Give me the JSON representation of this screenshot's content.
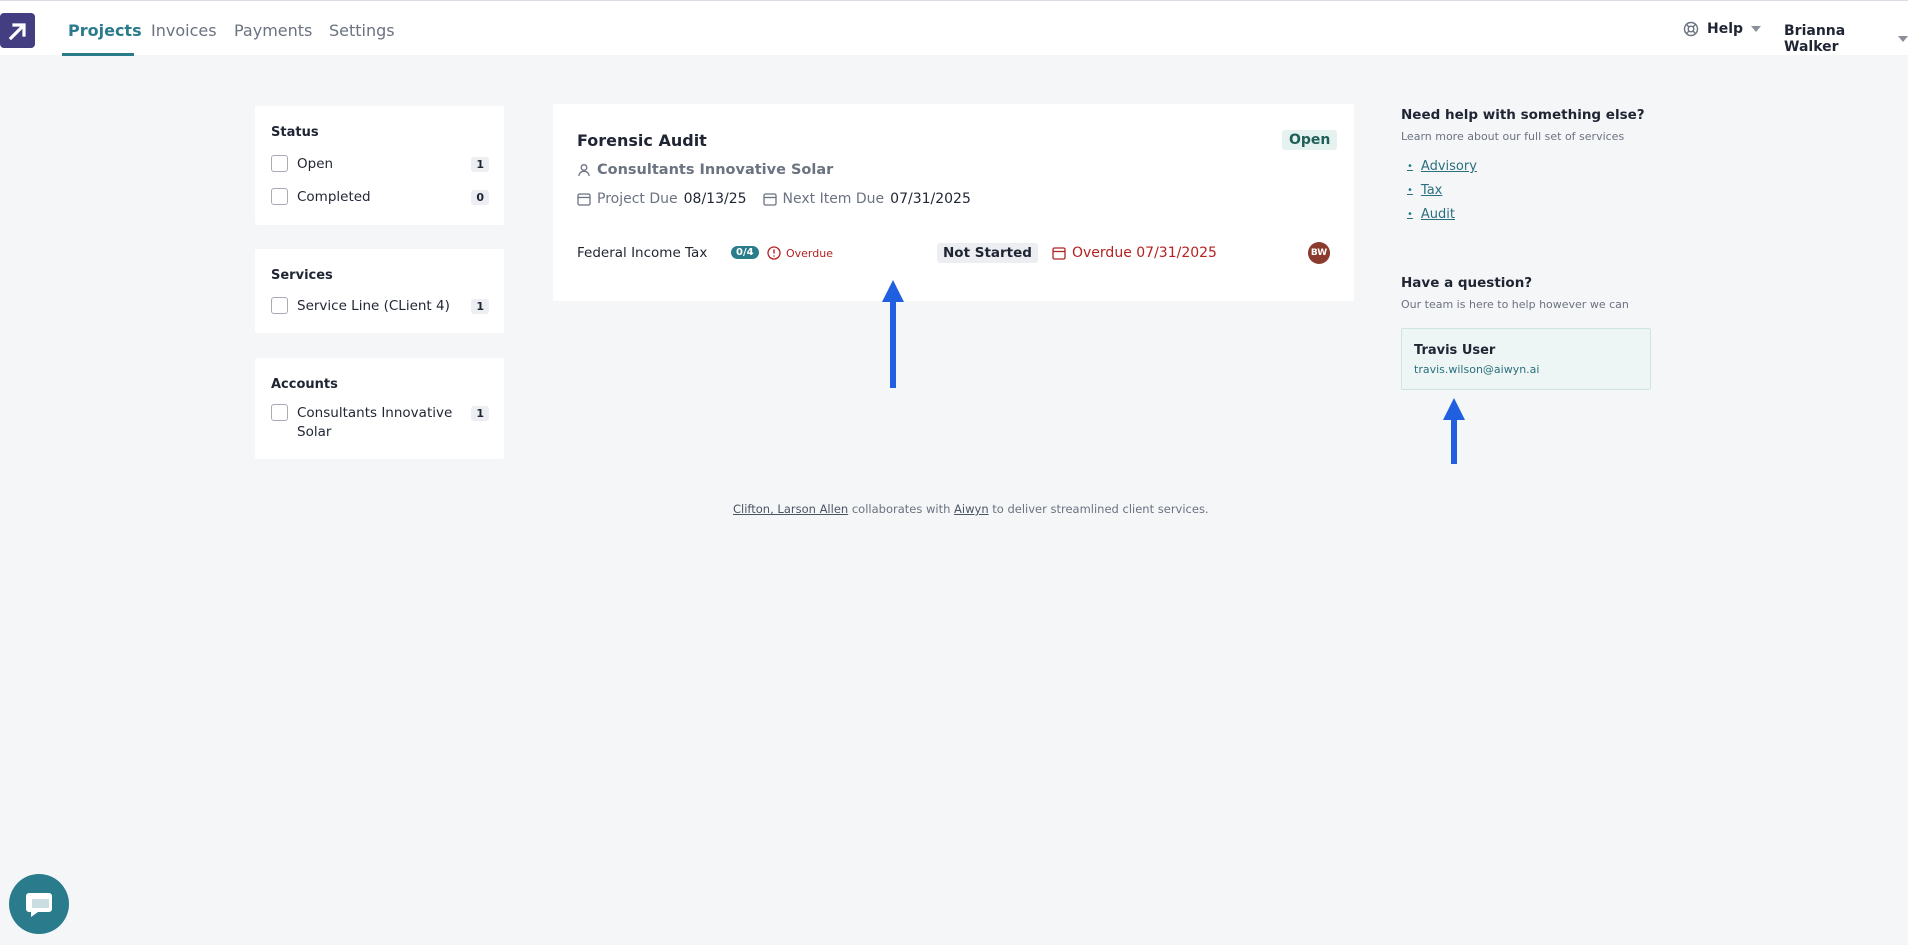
{
  "nav": {
    "tabs": [
      {
        "label": "Projects",
        "active": true
      },
      {
        "label": "Invoices",
        "active": false
      },
      {
        "label": "Payments",
        "active": false
      },
      {
        "label": "Settings",
        "active": false
      }
    ],
    "help_label": "Help",
    "user_name": "Brianna Walker"
  },
  "filters": {
    "status": {
      "title": "Status",
      "items": [
        {
          "label": "Open",
          "count": "1"
        },
        {
          "label": "Completed",
          "count": "0"
        }
      ]
    },
    "services": {
      "title": "Services",
      "items": [
        {
          "label": "Service Line (CLient 4)",
          "count": "1"
        }
      ]
    },
    "accounts": {
      "title": "Accounts",
      "items": [
        {
          "label": "Consultants Innovative Solar",
          "count": "1"
        }
      ]
    }
  },
  "project": {
    "title": "Forensic Audit",
    "status": "Open",
    "client": "Consultants Innovative Solar",
    "project_due_label": "Project Due",
    "project_due": "08/13/25",
    "next_item_due_label": "Next Item Due",
    "next_item_due": "07/31/2025",
    "task": {
      "name": "Federal Income Tax",
      "progress": "0/4",
      "overdue_flag": "Overdue",
      "status": "Not Started",
      "due": "Overdue 07/31/2025",
      "assignee_initials": "BW"
    }
  },
  "help_panel": {
    "heading": "Need help with something else?",
    "subheading": "Learn more about our full set of services",
    "links": [
      "Advisory",
      "Tax",
      "Audit"
    ],
    "question_heading": "Have a question?",
    "question_sub": "Our team is here to help however we can",
    "contact_name": "Travis User",
    "contact_email": "travis.wilson@aiwyn.ai"
  },
  "footer": {
    "firm": "Clifton, Larson Allen",
    "mid": " collaborates with ",
    "partner": "Aiwyn",
    "end": " to deliver streamlined client services."
  },
  "colors": {
    "accent": "#2a7c8c",
    "brand_logo": "#433d82",
    "overdue": "#b32121",
    "annotation_arrow": "#1f5fe0"
  },
  "icons": [
    "logo-arrow-icon",
    "help-lifebuoy-icon",
    "chevron-down-icon",
    "person-icon",
    "calendar-icon",
    "alert-circle-icon",
    "chat-icon",
    "annotation-arrow-icon"
  ]
}
